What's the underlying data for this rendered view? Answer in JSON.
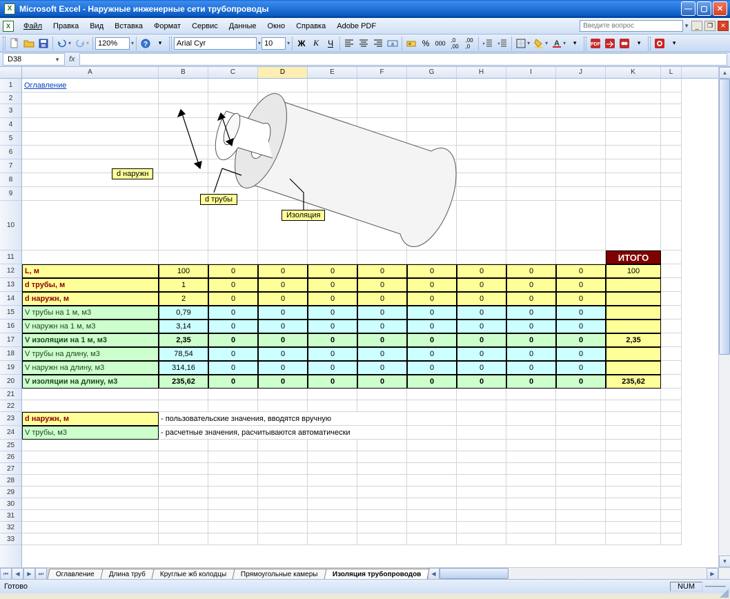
{
  "window": {
    "app_name": "Microsoft Excel",
    "doc_name": "Наружные инженерные сети трубопроводы",
    "full_title": "Microsoft Excel - Наружные инженерные сети трубопроводы"
  },
  "menus": {
    "file": "Файл",
    "edit": "Правка",
    "view": "Вид",
    "insert": "Вставка",
    "format": "Формат",
    "tools": "Сервис",
    "data": "Данные",
    "window": "Окно",
    "help": "Справка",
    "adobe": "Adobe PDF",
    "ask_placeholder": "Введите вопрос"
  },
  "toolbar": {
    "zoom": "120%",
    "font_name": "Arial Cyr",
    "font_size": "10"
  },
  "namebox": "D38",
  "columns": [
    "A",
    "B",
    "C",
    "D",
    "E",
    "F",
    "G",
    "H",
    "I",
    "J",
    "K",
    "L"
  ],
  "row_list": [
    {
      "n": "1",
      "h": "m"
    },
    {
      "n": "2",
      "h": "s"
    },
    {
      "n": "3",
      "h": "m"
    },
    {
      "n": "4",
      "h": "m"
    },
    {
      "n": "5",
      "h": "m"
    },
    {
      "n": "6",
      "h": "m"
    },
    {
      "n": "7",
      "h": "m"
    },
    {
      "n": "8",
      "h": "m"
    },
    {
      "n": "9",
      "h": "m"
    },
    {
      "n": "10",
      "h": "10"
    },
    {
      "n": "11",
      "h": "m"
    },
    {
      "n": "12",
      "h": "m"
    },
    {
      "n": "13",
      "h": "m"
    },
    {
      "n": "14",
      "h": "m"
    },
    {
      "n": "15",
      "h": "m"
    },
    {
      "n": "16",
      "h": "m"
    },
    {
      "n": "17",
      "h": "m"
    },
    {
      "n": "18",
      "h": "m"
    },
    {
      "n": "19",
      "h": "m"
    },
    {
      "n": "20",
      "h": "m"
    },
    {
      "n": "21",
      "h": "s"
    },
    {
      "n": "22",
      "h": "s"
    },
    {
      "n": "23",
      "h": "m"
    },
    {
      "n": "24",
      "h": "m"
    },
    {
      "n": "25",
      "h": "s"
    },
    {
      "n": "26",
      "h": "s"
    },
    {
      "n": "27",
      "h": "s"
    },
    {
      "n": "28",
      "h": "s"
    },
    {
      "n": "29",
      "h": "s"
    },
    {
      "n": "30",
      "h": "s"
    },
    {
      "n": "31",
      "h": "s"
    },
    {
      "n": "32",
      "h": "s"
    },
    {
      "n": "33",
      "h": "s"
    }
  ],
  "content": {
    "toc_link": "Оглавление",
    "diagram_labels": {
      "outer": "d наружн",
      "pipe": "d трубы",
      "isol": "Изоляция"
    },
    "itogo": "ИТОГО",
    "table": [
      {
        "label": "L, м",
        "style": "label-yellow",
        "data_style": "data-yellow",
        "vals": [
          "100",
          "0",
          "0",
          "0",
          "0",
          "0",
          "0",
          "0",
          "0"
        ],
        "sum": "100"
      },
      {
        "label": "d трубы, м",
        "style": "label-yellow",
        "data_style": "data-yellow",
        "vals": [
          "1",
          "0",
          "0",
          "0",
          "0",
          "0",
          "0",
          "0",
          "0"
        ],
        "sum": ""
      },
      {
        "label": "d наружн, м",
        "style": "label-yellow",
        "data_style": "data-yellow",
        "vals": [
          "2",
          "0",
          "0",
          "0",
          "0",
          "0",
          "0",
          "0",
          "0"
        ],
        "sum": ""
      },
      {
        "label": "V трубы на 1 м, м3",
        "style": "label-green",
        "data_style": "data-cyan",
        "vals": [
          "0,79",
          "0",
          "0",
          "0",
          "0",
          "0",
          "0",
          "0",
          "0"
        ],
        "sum": ""
      },
      {
        "label": "V наружн на 1 м, м3",
        "style": "label-green",
        "data_style": "data-cyan",
        "vals": [
          "3,14",
          "0",
          "0",
          "0",
          "0",
          "0",
          "0",
          "0",
          "0"
        ],
        "sum": ""
      },
      {
        "label": "V изоляции на 1 м, м3",
        "style": "label-green bold",
        "data_style": "data-green bold",
        "vals": [
          "2,35",
          "0",
          "0",
          "0",
          "0",
          "0",
          "0",
          "0",
          "0"
        ],
        "sum": "2,35"
      },
      {
        "label": "V трубы на длину, м3",
        "style": "label-green",
        "data_style": "data-cyan",
        "vals": [
          "78,54",
          "0",
          "0",
          "0",
          "0",
          "0",
          "0",
          "0",
          "0"
        ],
        "sum": ""
      },
      {
        "label": "V наружн на длину, м3",
        "style": "label-green",
        "data_style": "data-cyan",
        "vals": [
          "314,16",
          "0",
          "0",
          "0",
          "0",
          "0",
          "0",
          "0",
          "0"
        ],
        "sum": ""
      },
      {
        "label": "V изоляции  на длину, м3",
        "style": "label-green bold",
        "data_style": "data-green bold",
        "vals": [
          "235,62",
          "0",
          "0",
          "0",
          "0",
          "0",
          "0",
          "0",
          "0"
        ],
        "sum": "235,62"
      }
    ],
    "legend": {
      "user_label": "d наружн, м",
      "user_text": "- пользовательские значения, вводятся вручную",
      "calc_label": "V трубы, м3",
      "calc_text": "- расчетные значения, расчитываются автоматически"
    }
  },
  "sheets": {
    "list": [
      "Оглавление",
      "Длина труб",
      "Круглые жб колодцы",
      "Прямоугольные камеры",
      "Изоляция трубопроводов"
    ],
    "active_index": 4
  },
  "status": {
    "ready": "Готово",
    "num": "NUM"
  }
}
